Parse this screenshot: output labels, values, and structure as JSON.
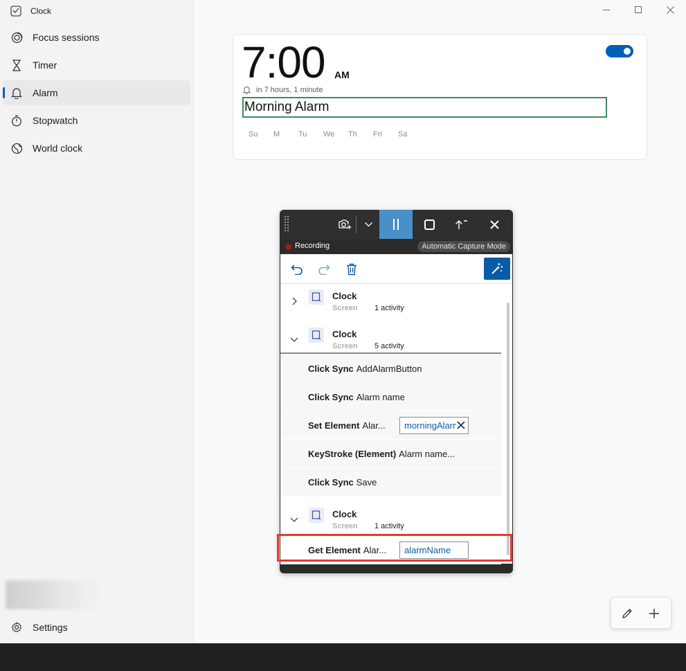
{
  "app": {
    "title": "Clock"
  },
  "sidebar": {
    "items": [
      {
        "label": "Focus sessions",
        "icon": "focus-icon"
      },
      {
        "label": "Timer",
        "icon": "hourglass-icon"
      },
      {
        "label": "Alarm",
        "icon": "bell-icon",
        "active": true
      },
      {
        "label": "Stopwatch",
        "icon": "stopwatch-icon"
      },
      {
        "label": "World clock",
        "icon": "globe-icon"
      }
    ],
    "settings_label": "Settings"
  },
  "alarm": {
    "time": "7:00",
    "ampm": "AM",
    "remaining": "in 7 hours, 1 minute",
    "name": "Morning Alarm",
    "days": [
      "Su",
      "M",
      "Tu",
      "We",
      "Th",
      "Fri",
      "Sa"
    ],
    "enabled": true
  },
  "recorder": {
    "status": "Recording",
    "mode": "Automatic Capture Mode",
    "screens": [
      {
        "title": "Clock",
        "type": "Screen",
        "count": "1 activity",
        "expanded": false
      },
      {
        "title": "Clock",
        "type": "Screen",
        "count": "5 activity",
        "expanded": true
      },
      {
        "title": "Clock",
        "type": "Screen",
        "count": "1 activity",
        "expanded": true
      }
    ],
    "activities": [
      {
        "action": "Click Sync",
        "target": "AddAlarmButton"
      },
      {
        "action": "Click Sync",
        "target": "Alarm name"
      },
      {
        "action": "Set Element",
        "target": "Alar...",
        "variable": "morningAlarm"
      },
      {
        "action": "KeyStroke (Element)",
        "target": "Alarm name..."
      },
      {
        "action": "Click Sync",
        "target": "Save"
      }
    ],
    "last_activity": {
      "action": "Get Element",
      "target": "Alar...",
      "variable": "alarmName"
    }
  },
  "colors": {
    "accent": "#005fb8",
    "recording": "#9b1c1c",
    "highlight": "#e53935",
    "focus_outline": "#3c8c5a"
  }
}
